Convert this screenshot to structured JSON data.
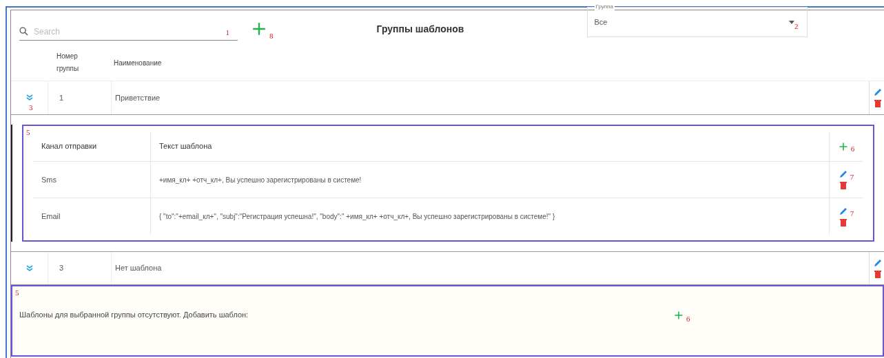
{
  "toolbar": {
    "search": {
      "placeholder": "Search",
      "annotation": "1"
    },
    "add_annotation": "8",
    "title": "Группы шаблонов",
    "group_select": {
      "label": "Группа",
      "value": "Все",
      "annotation": "2"
    }
  },
  "table": {
    "columns": [
      "Номер группы",
      "Наименование"
    ],
    "rows": [
      {
        "number": "1",
        "name": "Приветствие",
        "expanded": true,
        "annotation": "3",
        "details": {
          "annotation": "5",
          "kind": "table",
          "columns": [
            "Канал отправки",
            "Текст шаблона"
          ],
          "add_annotation": "6",
          "rows": [
            {
              "channel": "Sms",
              "text": "+имя_кл+ +отч_кл+, Вы успешно зарегистрированы в системе!",
              "annotation": "7"
            },
            {
              "channel": "Email",
              "text": "{ \"to\":\"+email_кл+\", \"subj\":\"Регистрация успешна!\", \"body\":\" +имя_кл+ +отч_кл+, Вы успешно зарегистрированы в системе!\" }",
              "annotation": "7"
            }
          ]
        }
      },
      {
        "number": "3",
        "name": "Нет шаблона",
        "expanded": true,
        "details": {
          "annotation": "5",
          "kind": "empty",
          "message": "Шаблоны для выбранной группы отсутствуют. Добавить шаблон:",
          "add_annotation": "6"
        }
      }
    ]
  }
}
